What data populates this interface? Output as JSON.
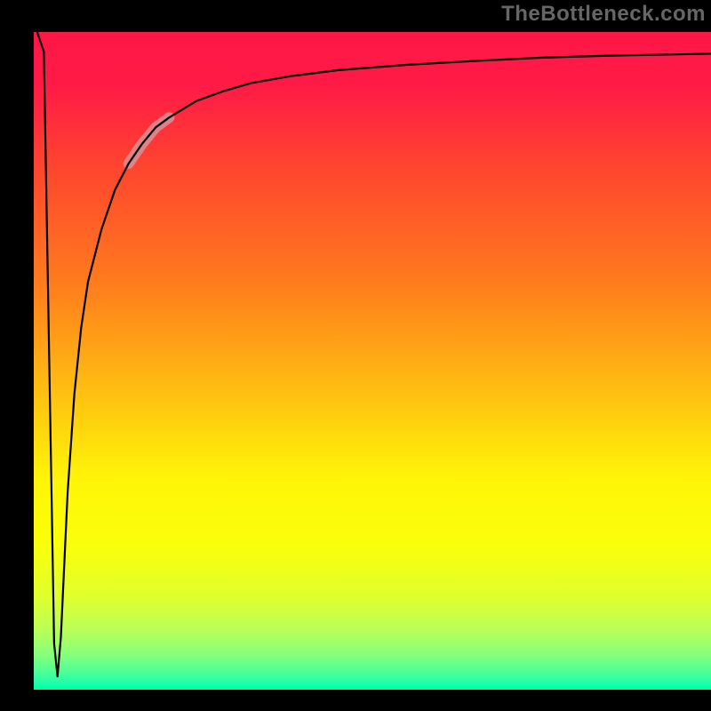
{
  "watermark": "TheBottleneck.com",
  "chart_data": {
    "type": "line",
    "title": "",
    "xlabel": "",
    "ylabel": "",
    "xlim": [
      0,
      100
    ],
    "ylim": [
      0,
      100
    ],
    "background_gradient_stops": [
      {
        "pos": 0.0,
        "color": "#ff1846"
      },
      {
        "pos": 0.08,
        "color": "#ff1a46"
      },
      {
        "pos": 0.2,
        "color": "#ff4330"
      },
      {
        "pos": 0.38,
        "color": "#ff7b1d"
      },
      {
        "pos": 0.53,
        "color": "#ffb812"
      },
      {
        "pos": 0.68,
        "color": "#fff508"
      },
      {
        "pos": 0.78,
        "color": "#faff0a"
      },
      {
        "pos": 0.86,
        "color": "#e0ff2e"
      },
      {
        "pos": 0.91,
        "color": "#b8ff58"
      },
      {
        "pos": 0.95,
        "color": "#80ff7e"
      },
      {
        "pos": 0.98,
        "color": "#3cffa0"
      },
      {
        "pos": 1.0,
        "color": "#00ffb0"
      }
    ],
    "series": [
      {
        "name": "bottleneck-curve",
        "x": [
          0.5,
          1.5,
          3.0,
          3.5,
          4.0,
          5.0,
          6.0,
          7.0,
          8.0,
          10.0,
          12.0,
          14.0,
          16.0,
          18.0,
          20.0,
          24.0,
          28.0,
          32.0,
          38.0,
          45.0,
          55.0,
          65.0,
          75.0,
          85.0,
          95.0,
          100.0
        ],
        "y": [
          100.0,
          97.0,
          7.0,
          2.0,
          8.0,
          30.0,
          45.0,
          55.0,
          62.0,
          70.0,
          76.0,
          80.0,
          83.0,
          85.5,
          87.0,
          89.5,
          91.0,
          92.2,
          93.3,
          94.2,
          95.0,
          95.6,
          96.1,
          96.4,
          96.6,
          96.7
        ]
      }
    ],
    "highlight_segment": {
      "series": "bottleneck-curve",
      "x_start": 14.0,
      "x_end": 20.0,
      "color": "#d99095"
    }
  }
}
